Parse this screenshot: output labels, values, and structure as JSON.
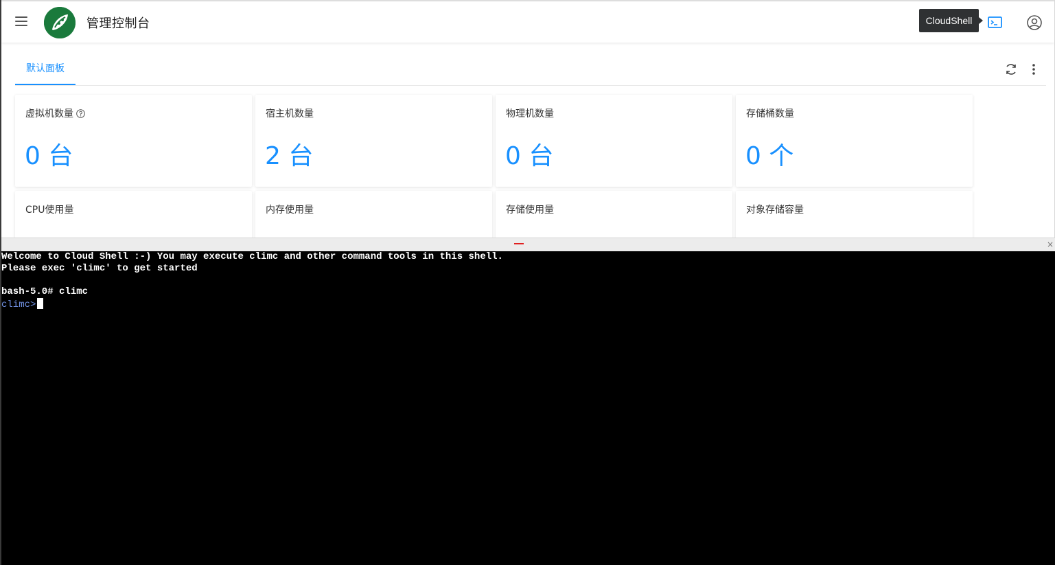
{
  "header": {
    "title": "管理控制台",
    "tooltip": "CloudShell"
  },
  "tabs": {
    "active_label": "默认面板"
  },
  "cards": [
    {
      "title": "虚拟机数量",
      "value": "0 台"
    },
    {
      "title": "宿主机数量",
      "value": "2 台"
    },
    {
      "title": "物理机数量",
      "value": "0 台"
    },
    {
      "title": "存储桶数量",
      "value": "0 个"
    },
    {
      "title": "CPU使用量",
      "value": ""
    },
    {
      "title": "内存使用量",
      "value": ""
    },
    {
      "title": "存储使用量",
      "value": ""
    },
    {
      "title": "对象存储容量",
      "value": ""
    }
  ],
  "terminal": {
    "lines": [
      "Welcome to Cloud Shell :-) You may execute climc and other command tools in this shell.",
      "Please exec 'climc' to get started",
      "",
      "bash-5.0# climc"
    ],
    "prompt": "climc>"
  },
  "splitter": {
    "close_glyph": "×"
  },
  "colors": {
    "accent": "#1890ff",
    "logo_bg": "#1a7a3c",
    "terminal_bg": "#000000",
    "prompt": "#6f8fe0"
  },
  "icons": {
    "menu": "menu-icon",
    "logo": "logo-icon",
    "cloudshell": "terminal-icon",
    "user": "user-circle-icon",
    "refresh": "refresh-icon",
    "more": "more-vertical-icon",
    "help": "help-circle-icon"
  }
}
